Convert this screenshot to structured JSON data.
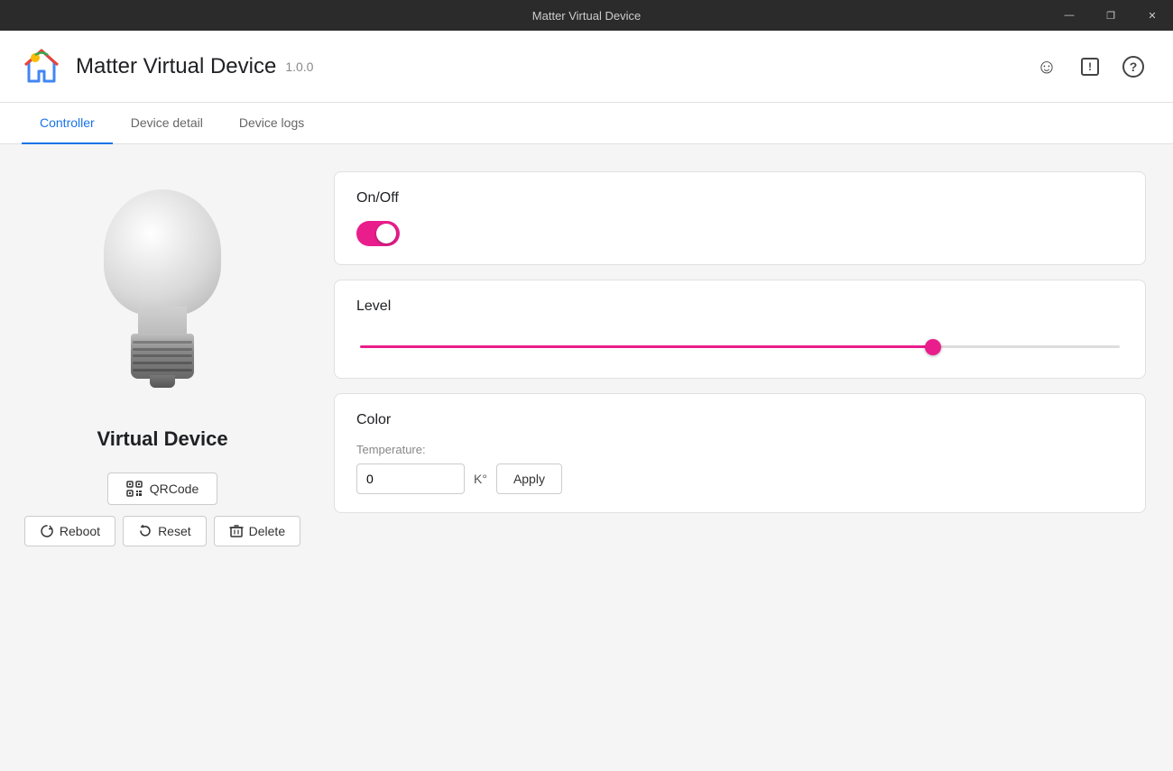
{
  "titlebar": {
    "title": "Matter Virtual Device",
    "min_btn": "—",
    "max_btn": "❐",
    "close_btn": "✕"
  },
  "header": {
    "title": "Matter Virtual Device",
    "version": "1.0.0",
    "icons": {
      "emoji": "☺",
      "alert": "⚠",
      "help": "?"
    }
  },
  "tabs": [
    {
      "id": "controller",
      "label": "Controller",
      "active": true
    },
    {
      "id": "device-detail",
      "label": "Device detail",
      "active": false
    },
    {
      "id": "device-logs",
      "label": "Device logs",
      "active": false
    }
  ],
  "device": {
    "name": "Virtual Device"
  },
  "controls": {
    "onoff": {
      "title": "On/Off",
      "state": true
    },
    "level": {
      "title": "Level",
      "value": 76,
      "min": 0,
      "max": 100
    },
    "color": {
      "title": "Color",
      "temp_label": "Temperature:",
      "temp_value": "0",
      "temp_unit": "K°",
      "apply_label": "Apply"
    }
  },
  "actions": {
    "qrcode_label": "QRCode",
    "reboot_label": "Reboot",
    "reset_label": "Reset",
    "delete_label": "Delete"
  }
}
